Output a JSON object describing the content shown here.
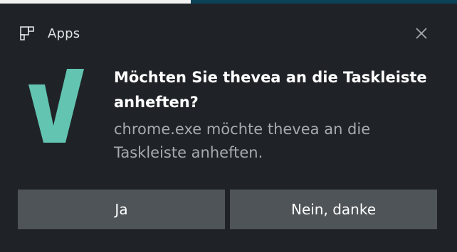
{
  "colors": {
    "background": "#1f2327",
    "button": "#4f5458",
    "logo": "#62c4b1",
    "title_text": "#ffffff",
    "message_text": "#a5abb0"
  },
  "header": {
    "app_name": "Apps",
    "app_icon": "app-tile-icon"
  },
  "close_icon": "close-icon",
  "logo_icon": "thevea-logo",
  "title": "Möchten Sie thevea an die Taskleiste anheften?",
  "message": "chrome.exe möchte thevea an die Taskleiste anheften.",
  "buttons": {
    "yes_label": "Ja",
    "no_label": "Nein, danke"
  }
}
